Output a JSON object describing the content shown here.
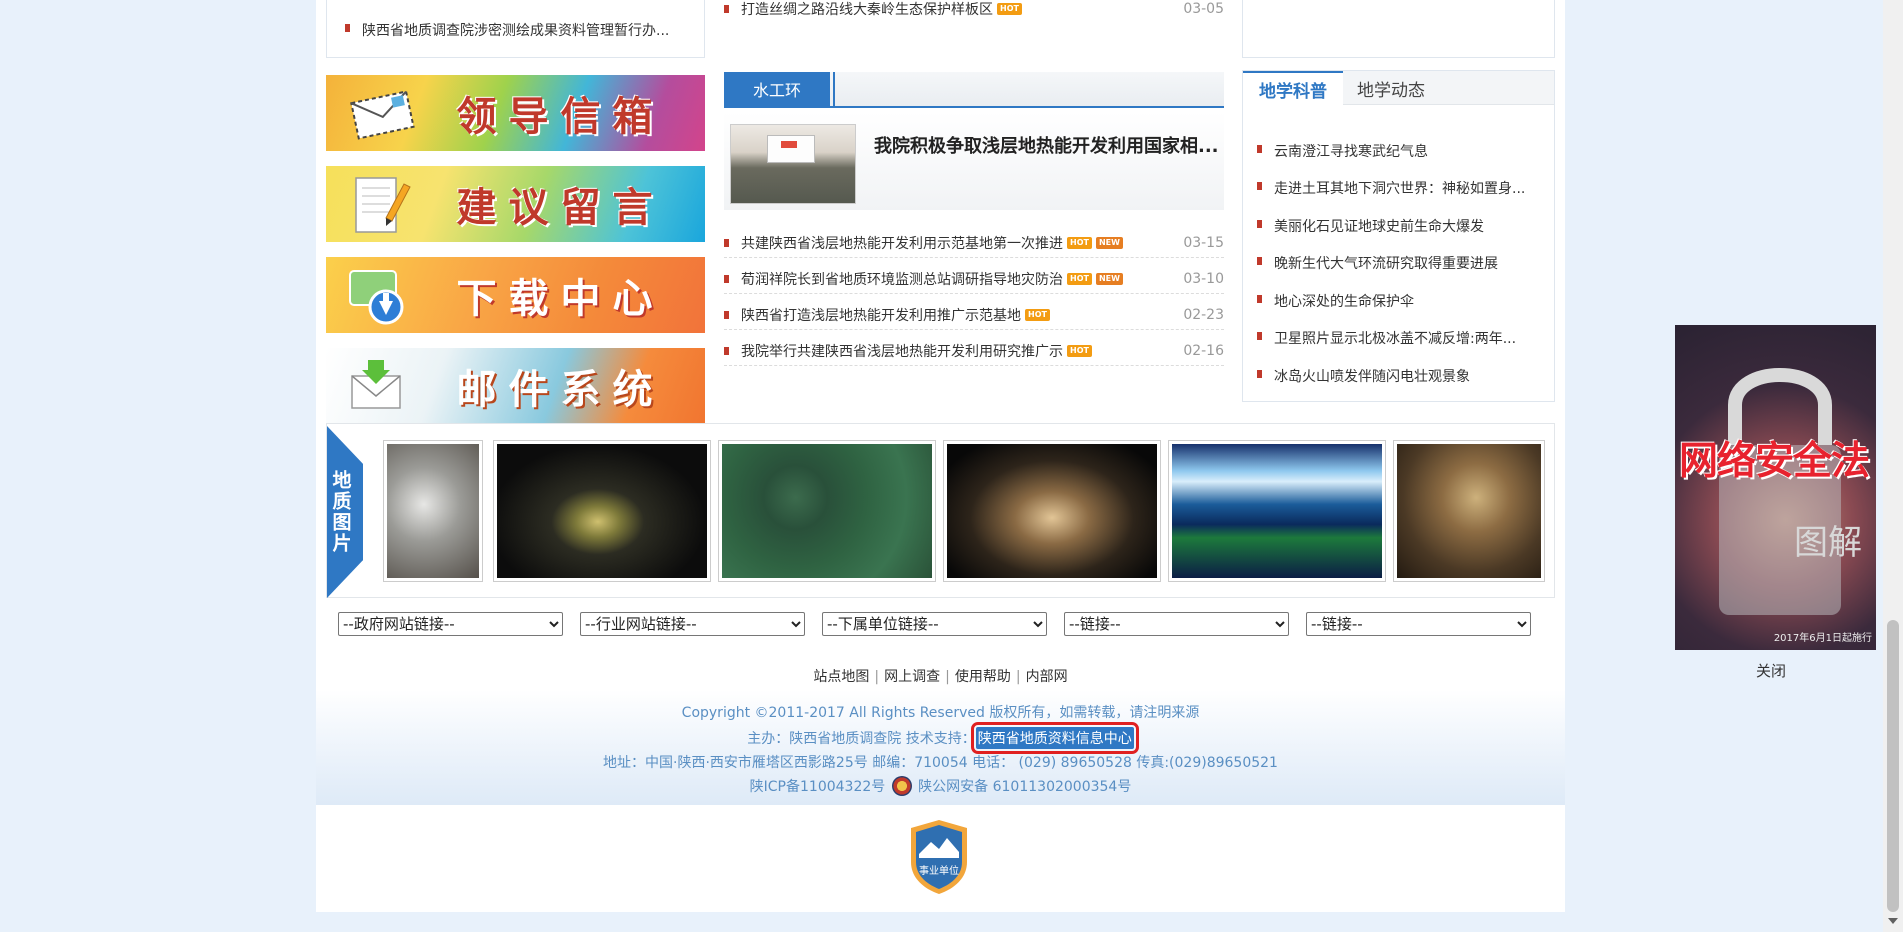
{
  "left_top": {
    "item": "陕西省地质调查院涉密测绘成果资料管理暂行办..."
  },
  "banners": [
    {
      "label": "领导信箱",
      "icon": "envelope-icon"
    },
    {
      "label": "建议留言",
      "icon": "notepad-pencil-icon"
    },
    {
      "label": "下载中心",
      "icon": "download-icon"
    },
    {
      "label": "邮件系统",
      "icon": "mail-icon"
    }
  ],
  "middle": {
    "prev_item": {
      "title": "打造丝绸之路沿线大秦岭生态保护样板区",
      "badges": [
        "HOT"
      ],
      "date": "03-05"
    },
    "tab_label": "水工环",
    "feature_title": "我院积极争取浅层地热能开发利用国家相...",
    "news": [
      {
        "title": "共建陕西省浅层地热能开发利用示范基地第一次推进",
        "badges": [
          "HOT",
          "NEW"
        ],
        "date": "03-15"
      },
      {
        "title": "荀润祥院长到省地质环境监测总站调研指导地灾防治",
        "badges": [
          "HOT",
          "NEW"
        ],
        "date": "03-10"
      },
      {
        "title": "陕西省打造浅层地热能开发利用推广示范基地",
        "badges": [
          "HOT"
        ],
        "date": "02-23"
      },
      {
        "title": "我院举行共建陕西省浅层地热能开发利用研究推广示",
        "badges": [
          "HOT"
        ],
        "date": "02-16"
      }
    ]
  },
  "right": {
    "tab_active": "地学科普",
    "tab_inactive": "地学动态",
    "items": [
      "云南澄江寻找寒武纪气息",
      "走进土耳其地下洞穴世界：神秘如置身...",
      "美丽化石见证地球史前生命大爆发",
      "晚新生代大气环流研究取得重要进展",
      "地心深处的生命保护伞",
      "卫星照片显示北极冰盖不减反增:两年...",
      "冰岛火山喷发伴随闪电壮观景象"
    ]
  },
  "gallery": {
    "label": "地质图片"
  },
  "selects": [
    "--政府网站链接--",
    "--行业网站链接--",
    "--下属单位链接--",
    "--链接--",
    "--链接--"
  ],
  "footer": {
    "links": [
      "站点地图",
      "网上调查",
      "使用帮助",
      "内部网"
    ],
    "copyright": "Copyright ©2011-2017 All Rights Reserved 版权所有，如需转载，请注明来源",
    "host_prefix": "主办：陕西省地质调查院 技术支持：",
    "tech_support": "陕西省地质资料信息中心",
    "address": "地址：中国·陕西·西安市雁塔区西影路25号 邮编：710054 电话：  (029)  89650528 传真:(029)89650521",
    "icp": "陕ICP备11004322号",
    "police": "陕公网安备 61011302000354号",
    "shield_label": "事业单位"
  },
  "float_ad": {
    "title": "网络安全法",
    "subtitle": "图解",
    "date": "2017年6月1日起施行",
    "close": "关闭"
  }
}
